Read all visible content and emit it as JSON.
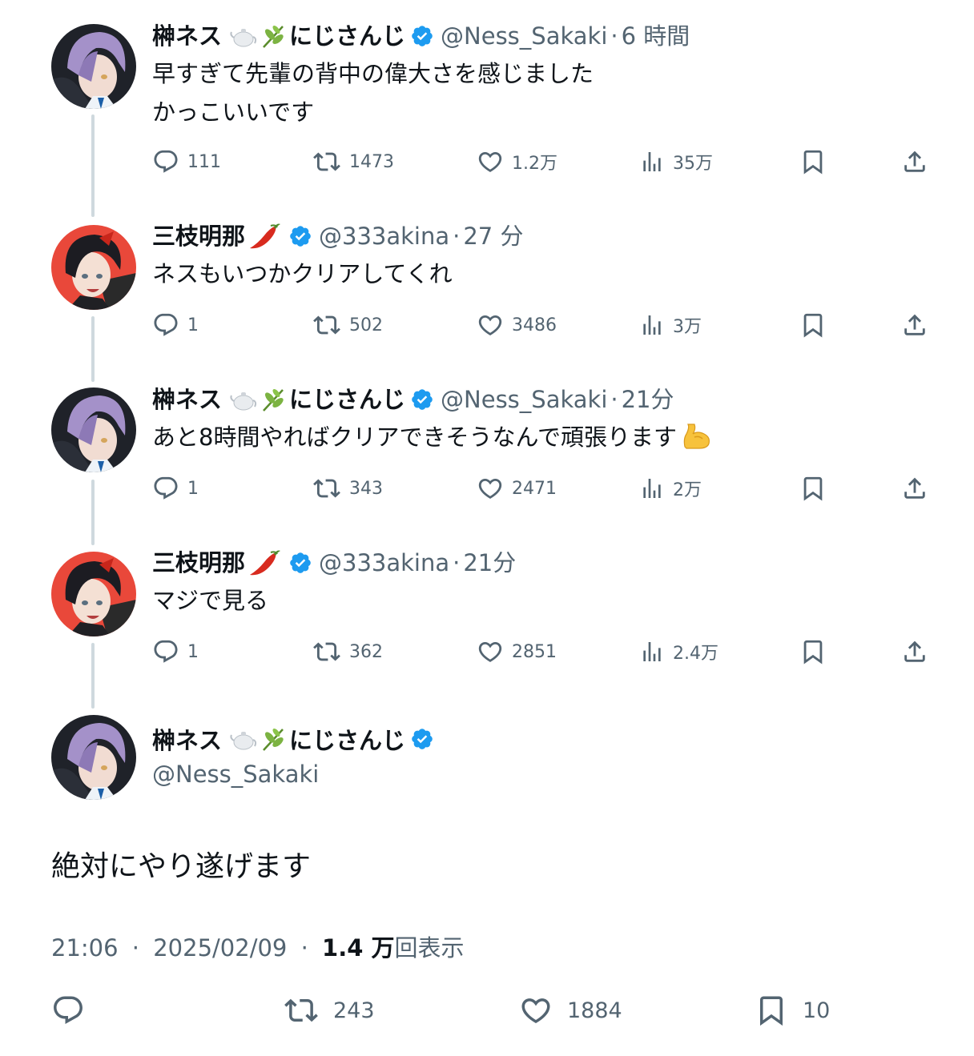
{
  "colors": {
    "text_primary": "#0f1419",
    "text_secondary": "#536471",
    "verified_blue": "#1d9bf0",
    "thread_line": "#cfd9de"
  },
  "thread": [
    {
      "avatar_icon": "avatar-purple-hair",
      "display_name": "榊ネス",
      "name_emojis": [
        "teapot-emoji",
        "herb-emoji"
      ],
      "name_suffix": "にじさんじ",
      "handle": "@Ness_Sakaki",
      "dot": "·",
      "time": "6 時間",
      "text": "早すぎて先輩の背中の偉大さを感じました\nかっこいいです",
      "stats": {
        "replies": "111",
        "retweets": "1473",
        "likes": "1.2万",
        "views": "35万"
      }
    },
    {
      "avatar_icon": "avatar-black-hair",
      "display_name": "三枝明那",
      "name_emojis": [
        "chili-pepper-emoji"
      ],
      "name_suffix": "",
      "handle": "@333akina",
      "dot": "·",
      "time": "27 分",
      "text": "ネスもいつかクリアしてくれ",
      "stats": {
        "replies": "1",
        "retweets": "502",
        "likes": "3486",
        "views": "3万"
      }
    },
    {
      "avatar_icon": "avatar-purple-hair",
      "display_name": "榊ネス",
      "name_emojis": [
        "teapot-emoji",
        "herb-emoji"
      ],
      "name_suffix": "にじさんじ",
      "handle": "@Ness_Sakaki",
      "dot": "·",
      "time": "21分",
      "text": "あと8時間やればクリアできそうなんで頑張ります",
      "text_emoji": "flexed-biceps-emoji",
      "stats": {
        "replies": "1",
        "retweets": "343",
        "likes": "2471",
        "views": "2万"
      }
    },
    {
      "avatar_icon": "avatar-black-hair",
      "display_name": "三枝明那",
      "name_emojis": [
        "chili-pepper-emoji"
      ],
      "name_suffix": "",
      "handle": "@333akina",
      "dot": "·",
      "time": "21分",
      "text": "マジで見る",
      "stats": {
        "replies": "1",
        "retweets": "362",
        "likes": "2851",
        "views": "2.4万"
      }
    }
  ],
  "main_tweet": {
    "avatar_icon": "avatar-purple-hair",
    "display_name": "榊ネス",
    "name_emojis": [
      "teapot-emoji",
      "herb-emoji"
    ],
    "name_suffix": "にじさんじ",
    "handle": "@Ness_Sakaki",
    "text": "絶対にやり遂げます",
    "time": "21:06",
    "date": "2025/02/09",
    "sep": "·",
    "views_count": "1.4 万",
    "views_label": "回表示",
    "stats": {
      "retweets": "243",
      "likes": "1884",
      "bookmarks": "10"
    }
  }
}
